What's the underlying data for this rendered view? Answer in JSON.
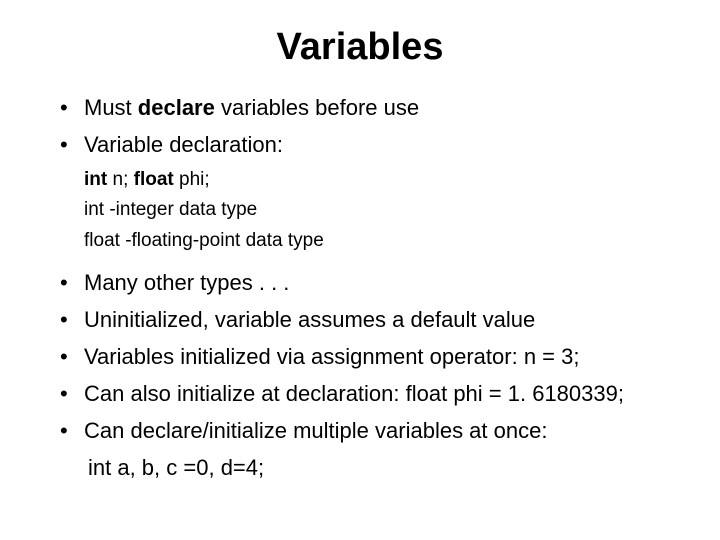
{
  "title": "Variables",
  "bullets": {
    "b1_pre": "Must ",
    "b1_strong": "declare",
    "b1_post": " variables before use",
    "b2": "Variable declaration:",
    "b3": "Many other types . . .",
    "b4": "Uninitialized, variable assumes a default value",
    "b5": "Variables initialized via assignment operator: n = 3;",
    "b6": "Can also initialize at declaration: float phi = 1. 6180339;",
    "b7": "Can declare/initialize multiple variables at once:",
    "b7_code": "int a, b, c =0, d=4;"
  },
  "sub": {
    "s1_pre": "int",
    "s1_mid": " n;  ",
    "s1_bold2": "float",
    "s1_post": " phi;",
    "s2": "int -integer data type",
    "s3": "float -floating-point data type"
  }
}
